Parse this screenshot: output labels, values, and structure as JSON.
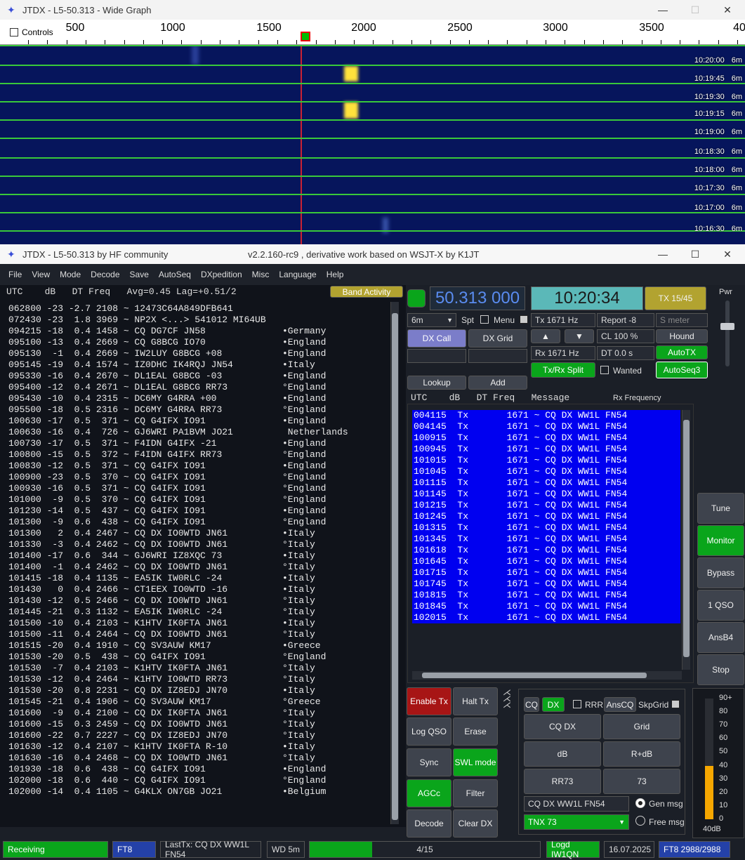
{
  "wide_graph": {
    "title": "JTDX - L5-50.313 - Wide Graph",
    "controls_label": "Controls",
    "ruler_labels": [
      "500",
      "1000",
      "1500",
      "2000",
      "2500",
      "3000",
      "3500",
      "40"
    ],
    "timestamps": [
      "10:20:00",
      "10:19:45",
      "10:19:30",
      "10:19:15",
      "10:19:00",
      "10:18:30",
      "10:18:00",
      "10:17:30",
      "10:17:00",
      "10:16:30"
    ],
    "band_label": "6m"
  },
  "main_window": {
    "title": "JTDX - L5-50.313  by HF community",
    "subtitle": "v2.2.160-rc9 , derivative work based on WSJT-X by K1JT"
  },
  "menu": [
    "File",
    "View",
    "Mode",
    "Decode",
    "Save",
    "AutoSeq",
    "DXpedition",
    "Misc",
    "Language",
    "Help"
  ],
  "band_activity": {
    "header": "UTC    dB   DT Freq   Avg=0.45 Lag=+0.51/2",
    "button": "Band Activity",
    "rows": [
      {
        "t": "062800 -23 -2.7 2108 ~ 12473C64A849DFB641",
        "c": ""
      },
      {
        "t": "072430 -23  1.8 3969 ~ NP2X <...> 541012 MI64UB",
        "c": ""
      },
      {
        "t": "094215 -18  0.4 1458 ~ CQ DG7CF JN58",
        "c": "•Germany"
      },
      {
        "t": "095100 -13  0.4 2669 ~ CQ G8BCG IO70",
        "c": "•England"
      },
      {
        "t": "095130  -1  0.4 2669 ~ IW2LUY G8BCG +08",
        "c": "•England"
      },
      {
        "t": "095145 -19  0.4 1574 ~ IZ0DHC IK4RQJ JN54",
        "c": "•Italy"
      },
      {
        "t": "095330 -16  0.4 2670 ~ DL1EAL G8BCG -03",
        "c": "•England"
      },
      {
        "t": "095400 -12  0.4 2671 ~ DL1EAL G8BCG RR73",
        "c": "°England"
      },
      {
        "t": "095430 -10  0.4 2315 ~ DC6MY G4RRA +00",
        "c": "•England"
      },
      {
        "t": "095500 -18  0.5 2316 ~ DC6MY G4RRA RR73",
        "c": "°England"
      },
      {
        "t": "100630 -17  0.5  371 ~ CQ G4IFX IO91",
        "c": "•England"
      },
      {
        "t": "100630 -16  0.4  726 ~ GJ6WRI PA1BVM JO21",
        "c": " Netherlands"
      },
      {
        "t": "100730 -17  0.5  371 ~ F4IDN G4IFX -21",
        "c": "•England"
      },
      {
        "t": "100800 -15  0.5  372 ~ F4IDN G4IFX RR73",
        "c": "°England"
      },
      {
        "t": "100830 -12  0.5  371 ~ CQ G4IFX IO91",
        "c": "•England"
      },
      {
        "t": "100900 -23  0.5  370 ~ CQ G4IFX IO91",
        "c": "°England"
      },
      {
        "t": "100930 -16  0.5  371 ~ CQ G4IFX IO91",
        "c": "°England"
      },
      {
        "t": "101000  -9  0.5  370 ~ CQ G4IFX IO91",
        "c": "°England"
      },
      {
        "t": "101230 -14  0.5  437 ~ CQ G4IFX IO91",
        "c": "•England"
      },
      {
        "t": "101300  -9  0.6  438 ~ CQ G4IFX IO91",
        "c": "°England"
      },
      {
        "t": "101300   2  0.4 2467 ~ CQ DX IO0WTD JN61",
        "c": "•Italy"
      },
      {
        "t": "101330  -3  0.4 2462 ~ CQ DX IO0WTD JN61",
        "c": "°Italy"
      },
      {
        "t": "101400 -17  0.6  344 ~ GJ6WRI IZ8XQC 73",
        "c": "•Italy"
      },
      {
        "t": "101400  -1  0.4 2462 ~ CQ DX IO0WTD JN61",
        "c": "°Italy"
      },
      {
        "t": "101415 -18  0.4 1135 ~ EA5IK IW0RLC -24",
        "c": "•Italy"
      },
      {
        "t": "101430   0  0.4 2466 ~ CT1EEX IO0WTD -16",
        "c": "•Italy"
      },
      {
        "t": "101430 -12  0.5 2466 ~ CQ DX IO0WTD JN61",
        "c": "°Italy"
      },
      {
        "t": "101445 -21  0.3 1132 ~ EA5IK IW0RLC -24",
        "c": "°Italy"
      },
      {
        "t": "101500 -10  0.4 2103 ~ K1HTV IK0FTA JN61",
        "c": "•Italy"
      },
      {
        "t": "101500 -11  0.4 2464 ~ CQ DX IO0WTD JN61",
        "c": "°Italy"
      },
      {
        "t": "101515 -20  0.4 1910 ~ CQ SV3AUW KM17",
        "c": "•Greece"
      },
      {
        "t": "101530 -20  0.5  438 ~ CQ G4IFX IO91",
        "c": "°England"
      },
      {
        "t": "101530  -7  0.4 2103 ~ K1HTV IK0FTA JN61",
        "c": "°Italy"
      },
      {
        "t": "101530 -12  0.4 2464 ~ K1HTV IO0WTD RR73",
        "c": "°Italy"
      },
      {
        "t": "101530 -20  0.8 2231 ~ CQ DX IZ8EDJ JN70",
        "c": "•Italy"
      },
      {
        "t": "101545 -21  0.4 1906 ~ CQ SV3AUW KM17",
        "c": "°Greece"
      },
      {
        "t": "101600  -9  0.4 2100 ~ CQ DX IK0FTA JN61",
        "c": "°Italy"
      },
      {
        "t": "101600 -15  0.3 2459 ~ CQ DX IO0WTD JN61",
        "c": "°Italy"
      },
      {
        "t": "101600 -22  0.7 2227 ~ CQ DX IZ8EDJ JN70",
        "c": "°Italy"
      },
      {
        "t": "101630 -12  0.4 2107 ~ K1HTV IK0FTA R-10",
        "c": "•Italy"
      },
      {
        "t": "101630 -16  0.4 2468 ~ CQ DX IO0WTD JN61",
        "c": "°Italy"
      },
      {
        "t": "101930 -18  0.6  438 ~ CQ G4IFX IO91",
        "c": "•England"
      },
      {
        "t": "102000 -18  0.6  440 ~ CQ G4IFX IO91",
        "c": "°England"
      },
      {
        "t": "102000 -14  0.4 1105 ~ G4KLX ON7GB JO21",
        "c": "•Belgium"
      }
    ]
  },
  "controls": {
    "frequency": "50.313 000",
    "clock": "10:20:34",
    "tx_period": "TX 15/45",
    "pwr_label": "Pwr",
    "band": "6m",
    "spt": "Spt",
    "menu_label": "Menu",
    "tx_freq": "Tx  1671  Hz",
    "rx_freq": "Rx  1671  Hz",
    "report": "Report -8",
    "s_meter": "S meter",
    "cl": "CL  100 %",
    "dt": "DT 0.0 s",
    "hound": "Hound",
    "autotx": "AutoTX",
    "autoseq": "AutoSeq3",
    "wanted": "Wanted",
    "txrx_split": "Tx/Rx Split",
    "dx_call": "DX Call",
    "dx_grid": "DX Grid",
    "lookup": "Lookup",
    "add": "Add",
    "up_arrow": "▲",
    "down_arrow": "▼"
  },
  "rx_panel": {
    "header": "UTC    dB   DT Freq   Message",
    "rx_freq_label": "Rx Frequency",
    "rows": [
      "004115  Tx       1671 ~ CQ DX WW1L FN54",
      "004145  Tx       1671 ~ CQ DX WW1L FN54",
      "100915  Tx       1671 ~ CQ DX WW1L FN54",
      "100945  Tx       1671 ~ CQ DX WW1L FN54",
      "101015  Tx       1671 ~ CQ DX WW1L FN54",
      "101045  Tx       1671 ~ CQ DX WW1L FN54",
      "101115  Tx       1671 ~ CQ DX WW1L FN54",
      "101145  Tx       1671 ~ CQ DX WW1L FN54",
      "101215  Tx       1671 ~ CQ DX WW1L FN54",
      "101245  Tx       1671 ~ CQ DX WW1L FN54",
      "101315  Tx       1671 ~ CQ DX WW1L FN54",
      "101345  Tx       1671 ~ CQ DX WW1L FN54",
      "101618  Tx       1671 ~ CQ DX WW1L FN54",
      "101645  Tx       1671 ~ CQ DX WW1L FN54",
      "101715  Tx       1671 ~ CQ DX WW1L FN54",
      "101745  Tx       1671 ~ CQ DX WW1L FN54",
      "101815  Tx       1671 ~ CQ DX WW1L FN54",
      "101845  Tx       1671 ~ CQ DX WW1L FN54",
      "102015  Tx       1671 ~ CQ DX WW1L FN54"
    ]
  },
  "right_buttons": [
    "Tune",
    "Monitor",
    "Bypass",
    "1 QSO",
    "AnsB4",
    "Stop"
  ],
  "bottom_buttons": {
    "enable_tx": "Enable Tx",
    "halt_tx": "Halt Tx",
    "log_qso": "Log QSO",
    "erase": "Erase",
    "sync": "Sync",
    "swl_mode": "SWL mode",
    "agcc": "AGCc",
    "filter": "Filter",
    "decode": "Decode",
    "clear_dx": "Clear DX"
  },
  "msg_panel": {
    "cq": "CQ",
    "dx": "DX",
    "rrr": "RRR",
    "anscq": "AnsCQ",
    "skpgrid": "SkpGrid",
    "cq_dx": "CQ DX",
    "grid": "Grid",
    "db": "dB",
    "r_db": "R+dB",
    "rr73": "RR73",
    "b73": "73",
    "gen_msg_text": "CQ DX WW1L FN54",
    "gen_msg": "Gen msg",
    "free_msg_text": "TNX 73",
    "free_msg": "Free msg"
  },
  "meter": {
    "labels": [
      "90+",
      "80",
      "70",
      "60",
      "50",
      "40",
      "30",
      "20",
      "10",
      "0"
    ],
    "value_label": "40dB",
    "level_db": 40
  },
  "status": {
    "receiving": "Receiving",
    "mode": "FT8",
    "last_tx": "LastTx: CQ DX WW1L FN54",
    "wd": "WD 5m",
    "progress": "4/15",
    "progress_fraction": 0.27,
    "logd": "Logd IW1QN",
    "date": "16.07.2025",
    "ft8_count": "FT8  2988/2988"
  },
  "colors": {
    "accent_green": "#0aa51b",
    "rx_blue": "#0000f0",
    "waterfall_bg": "#06155c"
  }
}
